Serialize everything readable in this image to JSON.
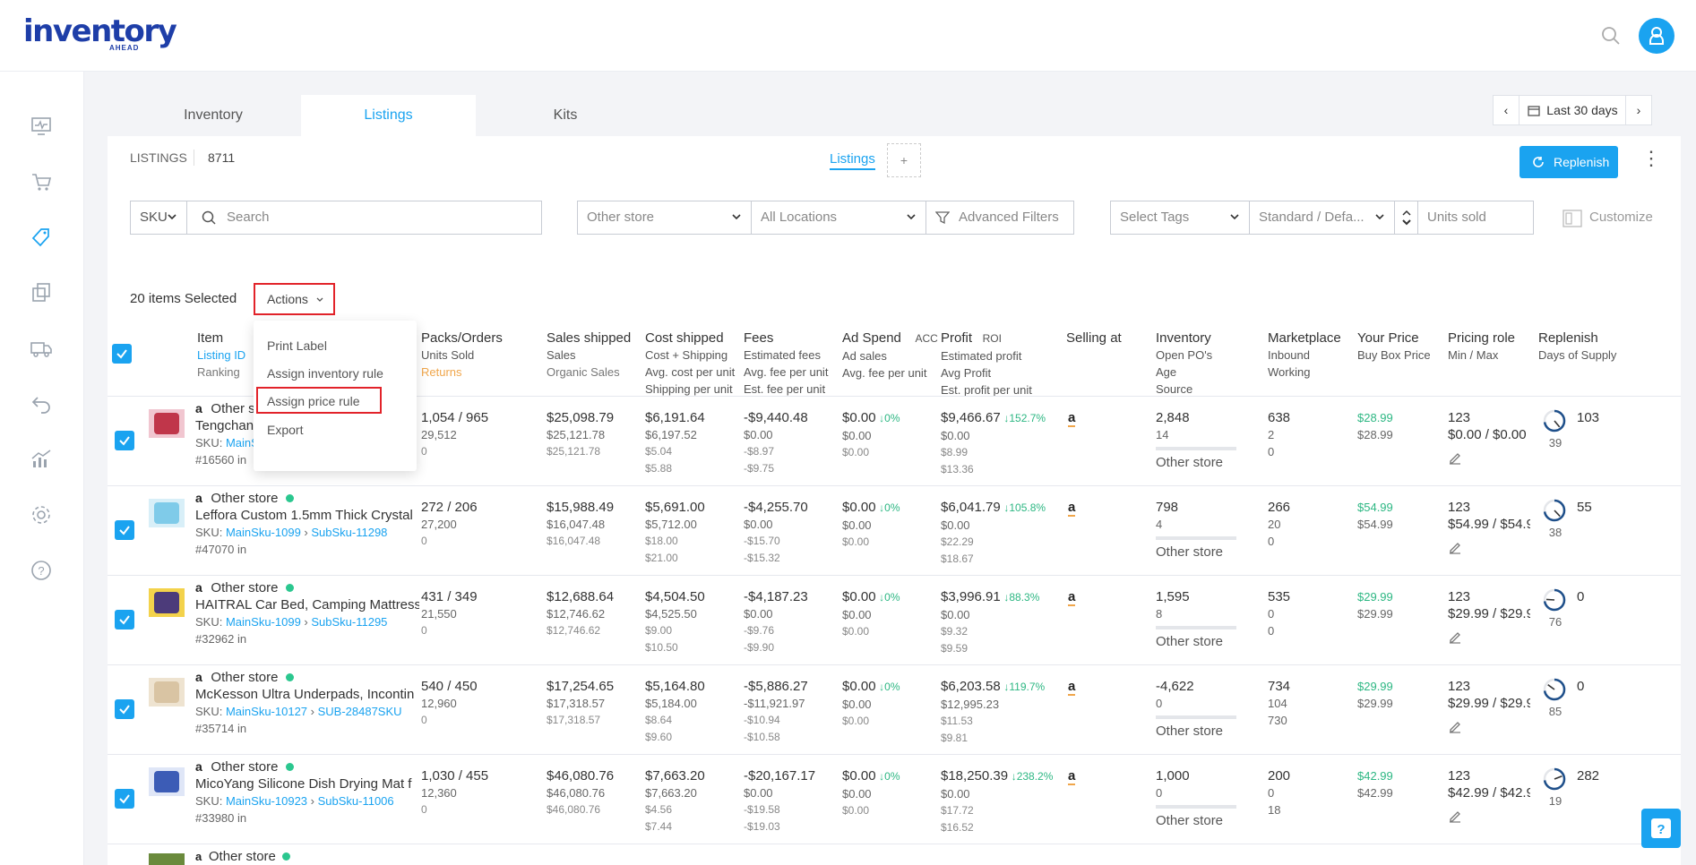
{
  "app": {
    "logo_main": "inventory",
    "logo_sub": "AHEAD",
    "accent": "#1aa3f0"
  },
  "sidebar": {
    "icons": [
      "dashboard-icon",
      "cart-icon",
      "tag-icon",
      "copy-icon",
      "truck-icon",
      "return-icon",
      "analytics-icon",
      "settings-icon",
      "help-circle-icon"
    ]
  },
  "tabs": [
    "Inventory",
    "Listings",
    "Kits"
  ],
  "date_range": {
    "prev": "‹",
    "label": "Last 30 days",
    "next": "›"
  },
  "panel": {
    "listings_label": "LISTINGS",
    "listings_count": "8711",
    "view_tab": "Listings",
    "add_view": "+",
    "replenish_label": "Replenish",
    "more": "⋮"
  },
  "filters": {
    "sku_select": "SKU",
    "search_placeholder": "Search",
    "store_select": "Other store",
    "location_select": "All Locations",
    "advanced_filters": "Advanced Filters",
    "tags_select": "Select Tags",
    "standard_select": "Standard / Defa...",
    "units_sold_placeholder": "Units sold",
    "customize": "Customize"
  },
  "selection": {
    "text": "20 items Selected",
    "actions_label": "Actions"
  },
  "actions_menu": [
    "Print Label",
    "Assign inventory rule",
    "Assign price rule",
    "Export"
  ],
  "columns": {
    "item": {
      "h1": "Item",
      "h2": "Listing ID",
      "h3": "Ranking"
    },
    "packs": {
      "h1": "Packs/Orders",
      "h2": "Units Sold",
      "h3": "Returns"
    },
    "sales": {
      "h1": "Sales shipped",
      "h2": "Sales",
      "h3": "Organic Sales"
    },
    "cost": {
      "h1": "Cost shipped",
      "h2": "Cost + Shipping",
      "h3": "Avg. cost per unit",
      "h4": "Shipping per unit"
    },
    "fees": {
      "h1": "Fees",
      "h2": "Estimated fees",
      "h3": "Avg. fee per unit",
      "h4": "Est. fee per unit"
    },
    "ad": {
      "h1": "Ad Spend",
      "h1b": "ACC",
      "h2": "Ad sales",
      "h3": "Avg. fee per unit"
    },
    "profit": {
      "h1": "Profit",
      "h1b": "ROI",
      "h2": "Estimated profit",
      "h3": "Avg Profit",
      "h4": "Est. profit per unit"
    },
    "selling": {
      "h1": "Selling at"
    },
    "inventory": {
      "h1": "Inventory",
      "h2": "Open PO's",
      "h3": "Age",
      "h4": "Source"
    },
    "marketplace": {
      "h1": "Marketplace",
      "h2": "Inbound",
      "h3": "Working"
    },
    "price": {
      "h1": "Your Price",
      "h2": "Buy Box Price"
    },
    "pricing": {
      "h1": "Pricing role",
      "h2": "Min / Max"
    },
    "replenish": {
      "h1": "Replenish",
      "h2": "Days of Supply"
    }
  },
  "rows": [
    {
      "store": "Other store",
      "name": "Tengchang",
      "sku_main": "MainS",
      "sku_sub": "",
      "rank": "#16560 in",
      "packs": "1,054 / 965",
      "units": "29,512",
      "returns": "0",
      "sales1": "$25,098.79",
      "sales2": "$25,121.78",
      "sales3": "$25,121.78",
      "cost1": "$6,191.64",
      "cost2": "$6,197.52",
      "cost3": "$5.04",
      "cost4": "$5.88",
      "fee1": "-$9,440.48",
      "fee2": "$0.00",
      "fee3": "-$8.97",
      "fee4": "-$9.75",
      "ad1": "$0.00",
      "ad_pct": "0%",
      "ad2": "$0.00",
      "ad3": "$0.00",
      "profit1": "$9,466.67",
      "roi": "152.7%",
      "profit2": "$0.00",
      "profit3": "$8.99",
      "profit4": "$13.36",
      "inv1": "2,848",
      "inv2": "14",
      "inv_src": "Other store",
      "mk1": "638",
      "mk2": "2",
      "mk3": "0",
      "price1": "$28.99",
      "price2": "$28.99",
      "role": "123",
      "minmax": "$0.00 / $0.00",
      "gauge": "39",
      "days": "103"
    },
    {
      "store": "Other store",
      "name": "Leffora Custom 1.5mm Thick Crystal",
      "sku_main": "MainSku-1099",
      "sku_sub": "SubSku-11298",
      "rank": "#47070 in",
      "packs": "272 / 206",
      "units": "27,200",
      "returns": "0",
      "sales1": "$15,988.49",
      "sales2": "$16,047.48",
      "sales3": "$16,047.48",
      "cost1": "$5,691.00",
      "cost2": "$5,712.00",
      "cost3": "$18.00",
      "cost4": "$21.00",
      "fee1": "-$4,255.70",
      "fee2": "$0.00",
      "fee3": "-$15.70",
      "fee4": "-$15.32",
      "ad1": "$0.00",
      "ad_pct": "0%",
      "ad2": "$0.00",
      "ad3": "$0.00",
      "profit1": "$6,041.79",
      "roi": "105.8%",
      "profit2": "$0.00",
      "profit3": "$22.29",
      "profit4": "$18.67",
      "inv1": "798",
      "inv2": "4",
      "inv_src": "Other store",
      "mk1": "266",
      "mk2": "20",
      "mk3": "0",
      "price1": "$54.99",
      "price2": "$54.99",
      "role": "123",
      "minmax": "$54.99 / $54.9",
      "gauge": "38",
      "days": "55"
    },
    {
      "store": "Other store",
      "name": "HAITRAL Car Bed, Camping Mattress",
      "sku_main": "MainSku-1099",
      "sku_sub": "SubSku-11295",
      "rank": "#32962 in",
      "packs": "431 / 349",
      "units": "21,550",
      "returns": "0",
      "sales1": "$12,688.64",
      "sales2": "$12,746.62",
      "sales3": "$12,746.62",
      "cost1": "$4,504.50",
      "cost2": "$4,525.50",
      "cost3": "$9.00",
      "cost4": "$10.50",
      "fee1": "-$4,187.23",
      "fee2": "$0.00",
      "fee3": "-$9.76",
      "fee4": "-$9.90",
      "ad1": "$0.00",
      "ad_pct": "0%",
      "ad2": "$0.00",
      "ad3": "$0.00",
      "profit1": "$3,996.91",
      "roi": "88.3%",
      "profit2": "$0.00",
      "profit3": "$9.32",
      "profit4": "$9.59",
      "inv1": "1,595",
      "inv2": "8",
      "inv_src": "Other store",
      "mk1": "535",
      "mk2": "0",
      "mk3": "0",
      "price1": "$29.99",
      "price2": "$29.99",
      "role": "123",
      "minmax": "$29.99 / $29.9",
      "gauge": "76",
      "days": "0"
    },
    {
      "store": "Other store",
      "name": "McKesson Ultra Underpads, Incontin",
      "sku_main": "MainSku-10127",
      "sku_sub": "SUB-28487SKU",
      "rank": "#35714 in",
      "packs": "540 / 450",
      "units": "12,960",
      "returns": "0",
      "sales1": "$17,254.65",
      "sales2": "$17,318.57",
      "sales3": "$17,318.57",
      "cost1": "$5,164.80",
      "cost2": "$5,184.00",
      "cost3": "$8.64",
      "cost4": "$9.60",
      "fee1": "-$5,886.27",
      "fee2": "-$11,921.97",
      "fee3": "-$10.94",
      "fee4": "-$10.58",
      "ad1": "$0.00",
      "ad_pct": "0%",
      "ad2": "$0.00",
      "ad3": "$0.00",
      "profit1": "$6,203.58",
      "roi": "119.7%",
      "profit2": "$12,995.23",
      "profit3": "$11.53",
      "profit4": "$9.81",
      "inv1": "-4,622",
      "inv2": "0",
      "inv_src": "Other store",
      "mk1": "734",
      "mk2": "104",
      "mk3": "730",
      "price1": "$29.99",
      "price2": "$29.99",
      "role": "123",
      "minmax": "$29.99 / $29.9",
      "gauge": "85",
      "days": "0"
    },
    {
      "store": "Other store",
      "name": "MicoYang Silicone Dish Drying Mat f",
      "sku_main": "MainSku-10923",
      "sku_sub": "SubSku-11006",
      "rank": "#33980 in",
      "packs": "1,030 / 455",
      "units": "12,360",
      "returns": "0",
      "sales1": "$46,080.76",
      "sales2": "$46,080.76",
      "sales3": "$46,080.76",
      "cost1": "$7,663.20",
      "cost2": "$7,663.20",
      "cost3": "$4.56",
      "cost4": "$7.44",
      "fee1": "-$20,167.17",
      "fee2": "$0.00",
      "fee3": "-$19.58",
      "fee4": "-$19.03",
      "ad1": "$0.00",
      "ad_pct": "0%",
      "ad2": "$0.00",
      "ad3": "$0.00",
      "profit1": "$18,250.39",
      "roi": "238.2%",
      "profit2": "$0.00",
      "profit3": "$17.72",
      "profit4": "$16.52",
      "inv1": "1,000",
      "inv2": "0",
      "inv_src": "Other store",
      "mk1": "200",
      "mk2": "0",
      "mk3": "18",
      "price1": "$42.99",
      "price2": "$42.99",
      "role": "123",
      "minmax": "$42.99 / $42.9",
      "gauge": "19",
      "days": "282"
    }
  ],
  "partial_row": {
    "store": "Other store"
  }
}
